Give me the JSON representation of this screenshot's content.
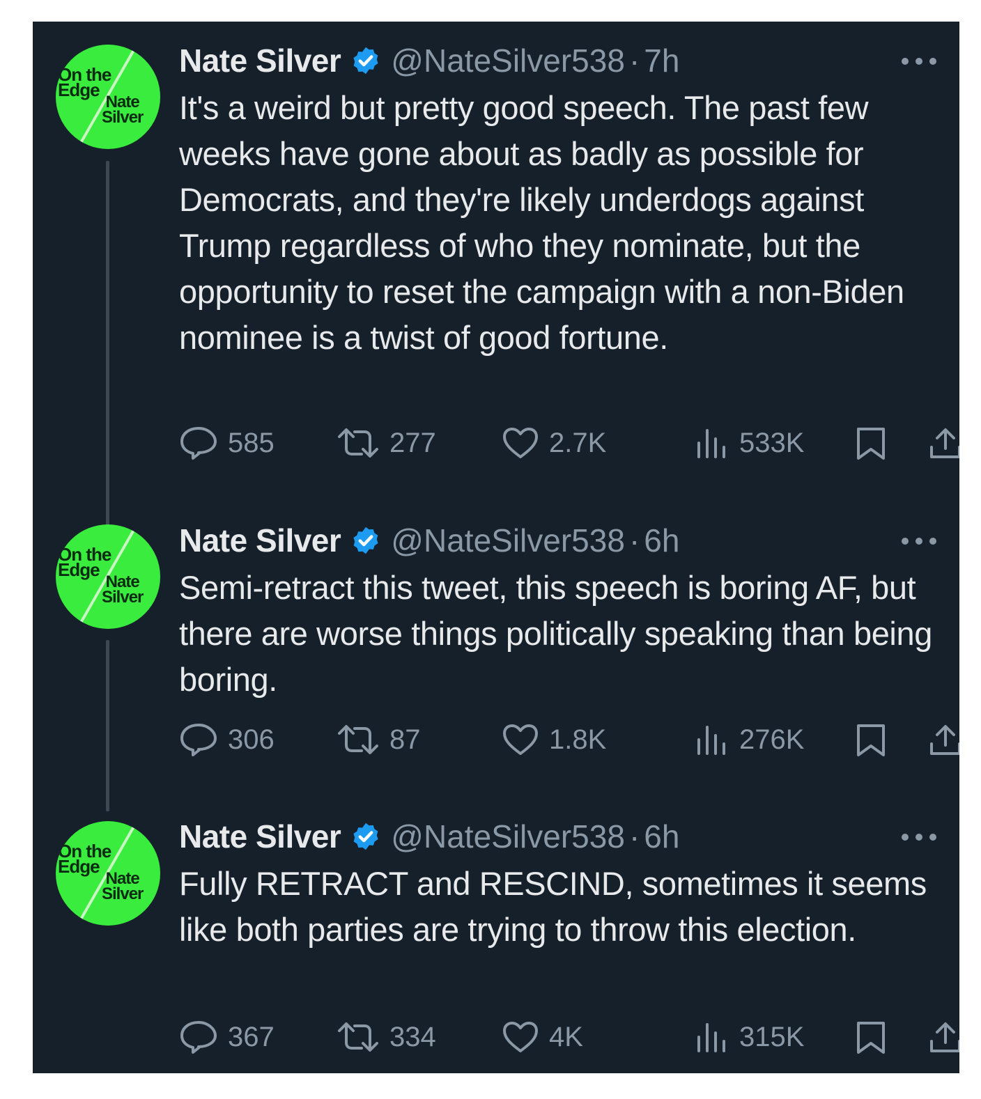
{
  "tweets": [
    {
      "author": "Nate Silver",
      "handle": "@NateSilver538",
      "separator": "·",
      "time": "7h",
      "text": "It's a weird but pretty good speech. The past few weeks have gone about as badly as possible for Democrats, and they're likely underdogs against Trump regardless of who they nominate, but the opportunity to reset the campaign with a non-Biden nominee is a twist of good fortune.",
      "replies": "585",
      "reposts": "277",
      "likes": "2.7K",
      "views": "533K"
    },
    {
      "author": "Nate Silver",
      "handle": "@NateSilver538",
      "separator": "·",
      "time": "6h",
      "text": "Semi-retract this tweet, this speech is boring AF, but there are worse things politically speaking than being boring.",
      "replies": "306",
      "reposts": "87",
      "likes": "1.8K",
      "views": "276K"
    },
    {
      "author": "Nate Silver",
      "handle": "@NateSilver538",
      "separator": "·",
      "time": "6h",
      "text": "Fully RETRACT and RESCIND, sometimes it seems like both parties are trying to throw this election.",
      "replies": "367",
      "reposts": "334",
      "likes": "4K",
      "views": "315K"
    }
  ],
  "avatar": {
    "line1": "On the",
    "line2": "Edge",
    "line3": "Nate",
    "line4": "Silver"
  },
  "icons": {
    "verified": "verified-badge-icon",
    "more": "more-icon",
    "reply": "reply-icon",
    "repost": "repost-icon",
    "like": "like-icon",
    "views": "views-icon",
    "bookmark": "bookmark-icon",
    "share": "share-icon"
  },
  "colors": {
    "background": "#15202b",
    "text": "#e7e9ea",
    "muted": "#8b98a5",
    "verified": "#1d9bf0",
    "avatar": "#39ec3d"
  }
}
